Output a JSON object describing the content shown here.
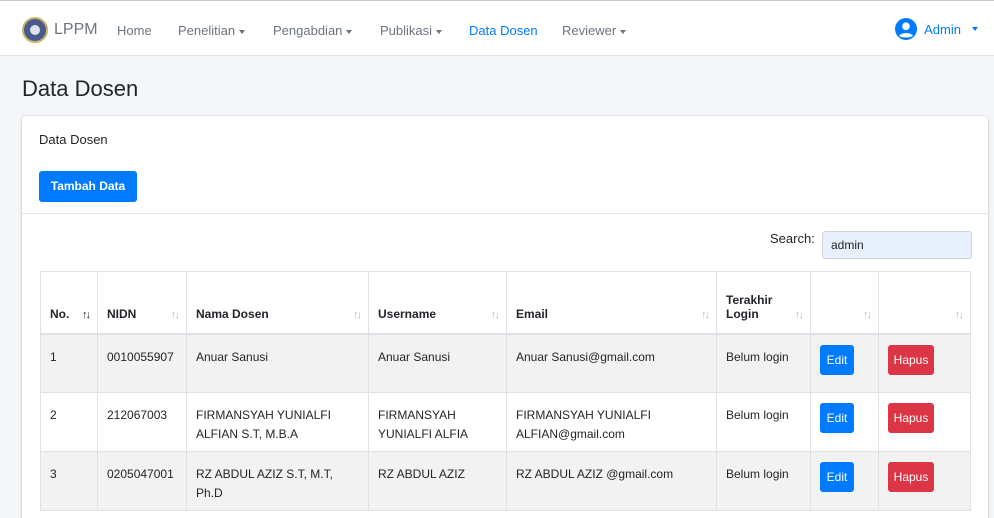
{
  "navbar": {
    "brand": "LPPM",
    "items": [
      {
        "label": "Home",
        "dropdown": false,
        "active": false
      },
      {
        "label": "Penelitian",
        "dropdown": true,
        "active": false
      },
      {
        "label": "Pengabdian",
        "dropdown": true,
        "active": false
      },
      {
        "label": "Publikasi",
        "dropdown": true,
        "active": false
      },
      {
        "label": "Data Dosen",
        "dropdown": false,
        "active": true
      },
      {
        "label": "Reviewer",
        "dropdown": true,
        "active": false
      }
    ],
    "user": {
      "label": "Admin",
      "icon": "user-circle-icon"
    }
  },
  "page": {
    "title": "Data Dosen"
  },
  "card": {
    "header_title": "Data Dosen",
    "add_button": "Tambah Data"
  },
  "search": {
    "label": "Search:",
    "value": "admin"
  },
  "table": {
    "columns": [
      "No.",
      "NIDN",
      "Nama Dosen",
      "Username",
      "Email",
      "Terakhir Login",
      "",
      ""
    ],
    "rows": [
      {
        "no": "1",
        "nidn": "0010055907",
        "nama": "Anuar Sanusi",
        "username": "Anuar Sanusi",
        "email": "Anuar Sanusi@gmail.com",
        "login": "Belum login",
        "edit": "Edit",
        "hapus": "Hapus"
      },
      {
        "no": "2",
        "nidn": "212067003",
        "nama": "FIRMANSYAH YUNIALFI ALFIAN S.T, M.B.A",
        "username": "FIRMANSYAH YUNIALFI ALFIA",
        "email": "FIRMANSYAH YUNIALFI ALFIAN@gmail.com",
        "login": "Belum login",
        "edit": "Edit",
        "hapus": "Hapus"
      },
      {
        "no": "3",
        "nidn": "0205047001",
        "nama": "RZ ABDUL AZIZ S.T, M.T, Ph.D",
        "username": "RZ ABDUL AZIZ",
        "email": "RZ ABDUL AZIZ @gmail.com",
        "login": "Belum login",
        "edit": "Edit",
        "hapus": "Hapus"
      }
    ]
  },
  "colors": {
    "primary": "#007bff",
    "danger": "#dc3545"
  }
}
